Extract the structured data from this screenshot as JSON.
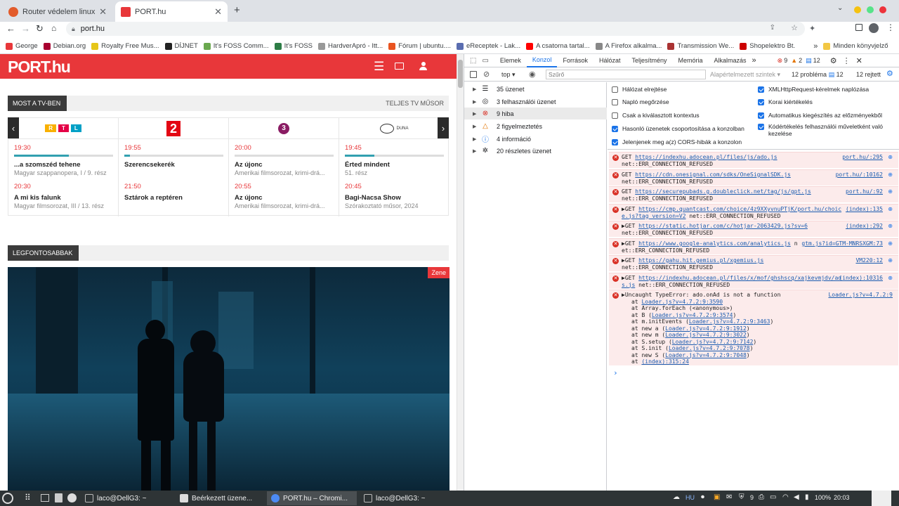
{
  "browser": {
    "tabs": [
      {
        "label": "Router védelem linux alapú..."
      },
      {
        "label": "PORT.hu"
      }
    ],
    "url": "port.hu",
    "bookmarks": [
      "George",
      "Debian.org",
      "Royalty Free Mus...",
      "DÍJNET",
      "It's FOSS Comm...",
      "It's FOSS",
      "HardverApró - Itt...",
      "Fórum | ubuntu....",
      "eReceptek - Lak...",
      "A csatorna tartal...",
      "A Firefox alkalma...",
      "Transmission We...",
      "Shopelektro Bt."
    ],
    "bookmarks_more": "»",
    "bookmarks_other": "Minden könyvjelző"
  },
  "site": {
    "logo": "PORT.hu",
    "now_on_tv": "MOST A TV-BEN",
    "full_tv": "TELJES TV MŰSOR",
    "channels": [
      {
        "logo": "RTL",
        "p1_time": "19:30",
        "p1_progress": 0.55,
        "p1_title": "...a szomszéd tehene",
        "p1_sub": "Magyar szappanopera, I / 9. rész",
        "p2_time": "20:30",
        "p2_title": "A mi kis falunk",
        "p2_sub": "Magyar filmsorozat, III / 13. rész"
      },
      {
        "logo": "2",
        "p1_time": "19:55",
        "p1_progress": 0.06,
        "p1_title": "Szerencsekerék",
        "p1_sub": "",
        "p2_time": "21:50",
        "p2_title": "Sztárok a reptéren",
        "p2_sub": ""
      },
      {
        "logo": "3",
        "p1_time": "20:00",
        "p1_progress": 0.0,
        "p1_title": "Az újonc",
        "p1_sub": "Amerikai filmsorozat, krimi-drá...",
        "p2_time": "20:55",
        "p2_title": "Az újonc",
        "p2_sub": "Amerikai filmsorozat, krimi-drá..."
      },
      {
        "logo": "DUNA",
        "p1_time": "19:45",
        "p1_progress": 0.3,
        "p1_title": "Érted mindent",
        "p1_sub": "51. rész",
        "p2_time": "20:45",
        "p2_title": "Bagi-Nacsa Show",
        "p2_sub": "Szórakoztató műsor, 2024"
      }
    ],
    "important": "LEGFONTOSABBAK",
    "hero_tag": "Zene"
  },
  "devtools": {
    "tabs": [
      "Elemek",
      "Konzol",
      "Források",
      "Hálózat",
      "Teljesítmény",
      "Memória",
      "Alkalmazás"
    ],
    "tabs_more": "»",
    "error_count": "9",
    "warning_count": "2",
    "info_count": "12",
    "context": "top",
    "filter_placeholder": "Szűrő",
    "levels": "Alapértelmezett szintek",
    "problems": "12 probléma",
    "problems_count": "12",
    "hidden": "12 rejtett",
    "sidebar": [
      {
        "label": "35 üzenet",
        "icon": "list-icon"
      },
      {
        "label": "3 felhasználói üzenet",
        "icon": "user-icon"
      },
      {
        "label": "9 hiba",
        "icon": "error-icon"
      },
      {
        "label": "2 figyelmeztetés",
        "icon": "warning-icon"
      },
      {
        "label": "4 információ",
        "icon": "info-icon"
      },
      {
        "label": "20 részletes üzenet",
        "icon": "bug-icon"
      }
    ],
    "settings": [
      {
        "label": "Hálózat elrejtése",
        "checked": false
      },
      {
        "label": "XMLHttpRequest-kérelmek naplózása",
        "checked": true
      },
      {
        "label": "Napló megőrzése",
        "checked": false
      },
      {
        "label": "Korai kiértékelés",
        "checked": true
      },
      {
        "label": "Csak a kiválasztott kontextus",
        "checked": false
      },
      {
        "label": "Automatikus kiegészítés az előzményekből",
        "checked": true
      },
      {
        "label": "Hasonló üzenetek csoportosítása a konzolban",
        "checked": true
      },
      {
        "label": "Kódértékelés felhasználói műveletként való kezelése",
        "checked": true
      },
      {
        "label": "Jelenjenek meg a(z) CORS-hibák a konzolon",
        "checked": true
      }
    ],
    "errors": [
      {
        "method": "GET",
        "url": "https://indexhu.adocean.pl/files/js/ado.js",
        "src": "port.hu/:295",
        "err": "net::ERR_CONNECTION_REFUSED"
      },
      {
        "method": "GET",
        "url": "https://cdn.onesignal.com/sdks/OneSignalSDK.js",
        "src": "port.hu/:10162",
        "err": "net::ERR_CONNECTION_REFUSED"
      },
      {
        "method": "GET",
        "url": "https://securepubads.g.doubleclick.net/tag/js/gpt.js",
        "src": "port.hu/:92",
        "err": "net::ERR_CONNECTION_REFUSED"
      },
      {
        "method": "GET",
        "url": "https://cmp.quantcast.com/choice/4z9XXyvnuPTjK/port.hu/choice.js?tag_version=V2",
        "src": "(index):135",
        "err": "net::ERR_CONNECTION_REFUSED"
      },
      {
        "method": "GET",
        "url": "https://static.hotjar.com/c/hotjar-2063429.js?sv=6",
        "src": "(index):292",
        "err": "net::ERR_CONNECTION_REFUSED"
      },
      {
        "method": "GET",
        "url": "https://www.google-analytics.com/analytics.js",
        "src": "gtm.js?id=GTM-MNRSXGM:73",
        "err": "net::ERR_CONNECTION_REFUSED"
      },
      {
        "method": "GET",
        "url": "https://gahu.hit.gemius.pl/xgemius.js",
        "src": "VM220:12",
        "err": "net::ERR_CONNECTION_REFUSED"
      },
      {
        "method": "GET",
        "url": "https://indexhu.adocean.pl/files/x/mof/ghshscq/xajkevmjdv/ads.js",
        "src": "(index):10316",
        "err": "net::ERR_CONNECTION_REFUSED"
      }
    ],
    "exception": {
      "title": "Uncaught TypeError: ado.onAd is not a function",
      "src": "Loader.js?v=4.7.2:9",
      "stack": [
        {
          "pre": "at ",
          "link": "Loader.js?v=4.7.2:9:3590",
          "post": ""
        },
        {
          "pre": "at Array.forEach (<anonymous>)",
          "link": "",
          "post": ""
        },
        {
          "pre": "at B (",
          "link": "Loader.js?v=4.7.2:9:3574",
          "post": ")"
        },
        {
          "pre": "at m.initEvents (",
          "link": "Loader.js?v=4.7.2:9:3463",
          "post": ")"
        },
        {
          "pre": "at new a (",
          "link": "Loader.js?v=4.7.2:9:1912",
          "post": ")"
        },
        {
          "pre": "at new m (",
          "link": "Loader.js?v=4.7.2:9:3022",
          "post": ")"
        },
        {
          "pre": "at S.setup (",
          "link": "Loader.js?v=4.7.2:9:7142",
          "post": ")"
        },
        {
          "pre": "at S.init (",
          "link": "Loader.js?v=4.7.2:9:7078",
          "post": ")"
        },
        {
          "pre": "at new S (",
          "link": "Loader.js?v=4.7.2:9:7048",
          "post": ")"
        },
        {
          "pre": "at ",
          "link": "(index):315:24",
          "post": ""
        }
      ]
    },
    "prompt": "›"
  },
  "taskbar": {
    "windows": [
      {
        "label": "laco@DellG3: ~"
      },
      {
        "label": "Beérkezett üzene..."
      },
      {
        "label": "PORT.hu – Chromi..."
      },
      {
        "label": "laco@DellG3: ~"
      }
    ],
    "lang": "HU",
    "count": "9",
    "battery": "100%",
    "clock": "20:03"
  }
}
